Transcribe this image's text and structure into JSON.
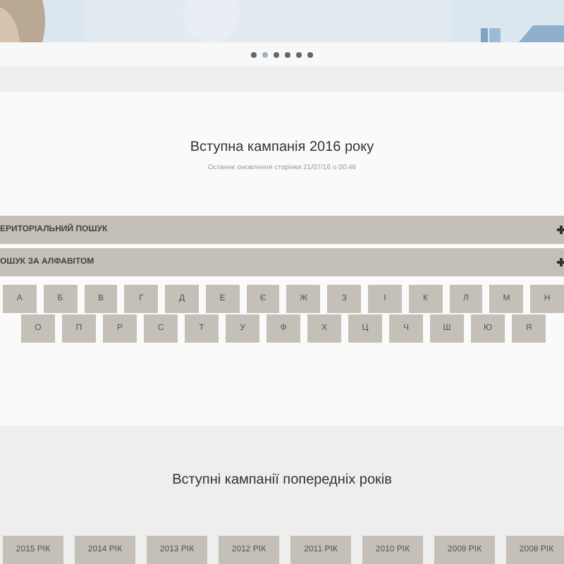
{
  "carousel": {
    "dots": [
      {
        "selected": false
      },
      {
        "selected": true
      },
      {
        "selected": false
      },
      {
        "selected": false
      },
      {
        "selected": false
      },
      {
        "selected": false
      }
    ]
  },
  "campaign": {
    "title": "Вступна кампанія 2016 року",
    "updated": "Останнє оновлення сторінки 21/07/16 о 00:46"
  },
  "accordion": [
    {
      "label": "ЕРИТОРІАЛЬНИЙ ПОШУК"
    },
    {
      "label": "ОШУК ЗА АЛФАВІТОМ"
    }
  ],
  "alphabet_rows": [
    [
      "А",
      "Б",
      "В",
      "Г",
      "Д",
      "Е",
      "Є",
      "Ж",
      "З",
      "І",
      "К",
      "Л",
      "М",
      "Н"
    ],
    [
      "О",
      "П",
      "Р",
      "С",
      "Т",
      "У",
      "Ф",
      "Х",
      "Ц",
      "Ч",
      "Ш",
      "Ю",
      "Я"
    ]
  ],
  "previous": {
    "title": "Вступні кампанії попередніх років",
    "years": [
      "2015 РІК",
      "2014 РІК",
      "2013 РІК",
      "2012 РІК",
      "2011 РІК",
      "2010 РІК",
      "2009 РІК",
      "2008 РІК"
    ]
  }
}
